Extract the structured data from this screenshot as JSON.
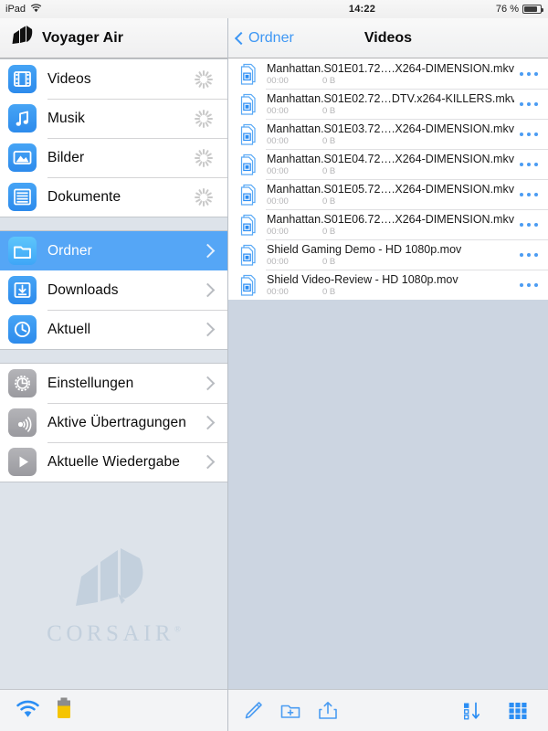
{
  "status_bar": {
    "device": "iPad",
    "wifi_icon": "wifi-icon",
    "time": "14:22",
    "battery_percent": "76 %",
    "battery_icon": "battery-icon"
  },
  "sidebar": {
    "header": {
      "logo_icon": "voyager-sails-logo",
      "title": "Voyager Air"
    },
    "groups": [
      {
        "items": [
          {
            "label": "Videos",
            "icon": "film-icon",
            "icon_color": "blue",
            "accessory": "spinner",
            "selected": false
          },
          {
            "label": "Musik",
            "icon": "music-note-icon",
            "icon_color": "blue",
            "accessory": "spinner",
            "selected": false
          },
          {
            "label": "Bilder",
            "icon": "photo-icon",
            "icon_color": "blue",
            "accessory": "spinner",
            "selected": false
          },
          {
            "label": "Dokumente",
            "icon": "document-icon",
            "icon_color": "blue",
            "accessory": "spinner",
            "selected": false
          }
        ]
      },
      {
        "items": [
          {
            "label": "Ordner",
            "icon": "folder-icon",
            "icon_color": "blue",
            "accessory": "chevron",
            "selected": true
          },
          {
            "label": "Downloads",
            "icon": "download-icon",
            "icon_color": "blue",
            "accessory": "chevron",
            "selected": false
          },
          {
            "label": "Aktuell",
            "icon": "clock-icon",
            "icon_color": "blue",
            "accessory": "chevron",
            "selected": false
          }
        ]
      },
      {
        "items": [
          {
            "label": "Einstellungen",
            "icon": "gear-icon",
            "icon_color": "gray",
            "accessory": "chevron",
            "selected": false
          },
          {
            "label": "Aktive Übertragungen",
            "icon": "transfers-icon",
            "icon_color": "gray",
            "accessory": "chevron",
            "selected": false
          },
          {
            "label": "Aktuelle Wiedergabe",
            "icon": "play-icon",
            "icon_color": "gray",
            "accessory": "chevron",
            "selected": false
          }
        ]
      }
    ],
    "watermark": {
      "brand": "CORSAIR",
      "trademark": "®",
      "logo_icon": "corsair-sails-logo"
    },
    "bottom_bar": [
      {
        "icon": "wifi-status-icon",
        "color": "#2b8ef4"
      },
      {
        "icon": "battery-status-icon",
        "color": "#f5c400"
      }
    ]
  },
  "detail": {
    "nav": {
      "back_label": "Ordner",
      "back_icon": "chevron-left-icon",
      "title": "Videos"
    },
    "files": [
      {
        "name": "Manhattan.S01E01.72….X264-DIMENSION.mkv",
        "duration": "00:00",
        "size": "0 B",
        "icon": "video-file-icon"
      },
      {
        "name": "Manhattan.S01E02.72…DTV.x264-KILLERS.mkv",
        "duration": "00:00",
        "size": "0 B",
        "icon": "video-file-icon"
      },
      {
        "name": "Manhattan.S01E03.72….X264-DIMENSION.mkv",
        "duration": "00:00",
        "size": "0 B",
        "icon": "video-file-icon"
      },
      {
        "name": "Manhattan.S01E04.72….X264-DIMENSION.mkv",
        "duration": "00:00",
        "size": "0 B",
        "icon": "video-file-icon"
      },
      {
        "name": "Manhattan.S01E05.72….X264-DIMENSION.mkv",
        "duration": "00:00",
        "size": "0 B",
        "icon": "video-file-icon"
      },
      {
        "name": "Manhattan.S01E06.72….X264-DIMENSION.mkv",
        "duration": "00:00",
        "size": "0 B",
        "icon": "video-file-icon"
      },
      {
        "name": "Shield Gaming Demo - HD 1080p.mov",
        "duration": "00:00",
        "size": "0 B",
        "icon": "video-file-icon"
      },
      {
        "name": "Shield Video-Review - HD 1080p.mov",
        "duration": "00:00",
        "size": "0 B",
        "icon": "video-file-icon"
      }
    ],
    "row_menu_icon": "more-options-icon",
    "toolbar": {
      "left": [
        {
          "icon": "edit-pencil-icon"
        },
        {
          "icon": "new-folder-icon"
        },
        {
          "icon": "share-upload-icon"
        }
      ],
      "right": [
        {
          "icon": "sort-icon"
        },
        {
          "icon": "grid-view-icon"
        }
      ]
    }
  },
  "colors": {
    "accent_blue": "#2b8ef4",
    "selection_blue": "#55a6f6",
    "list_background": "#ccd5e1",
    "toolbar_background": "#f3f4f6",
    "battery_yellow": "#f5c400"
  }
}
